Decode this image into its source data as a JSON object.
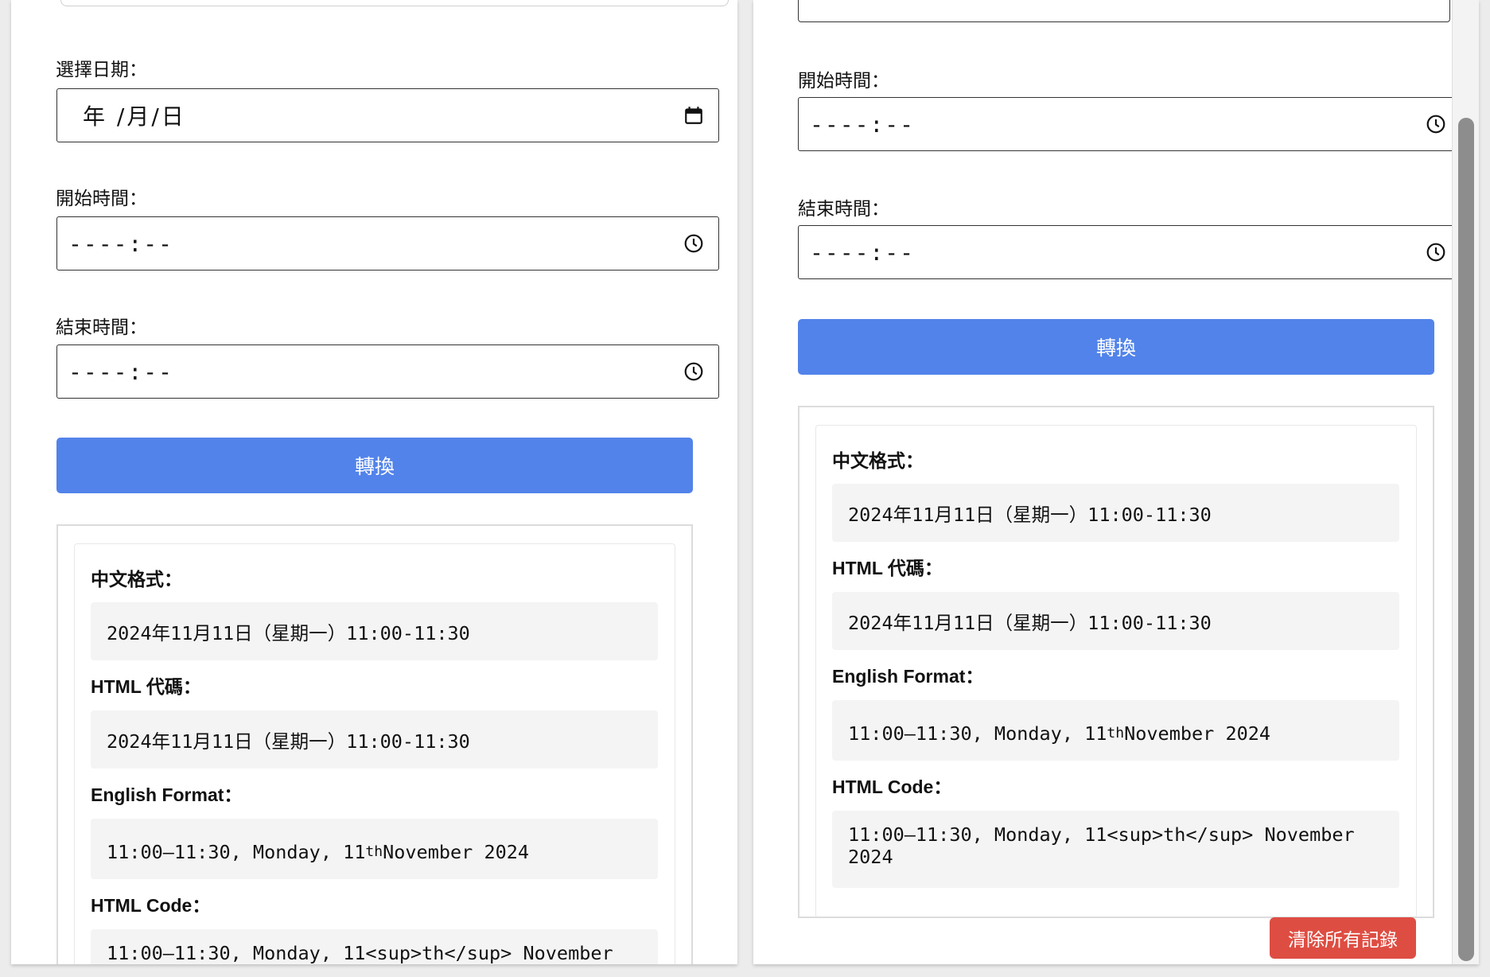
{
  "left": {
    "date_label": "選擇日期：",
    "date_value": "年 /月/日",
    "start_label": "開始時間：",
    "start_value": "----:--",
    "end_label": "結束時間：",
    "end_value": "----:--",
    "convert_label": "轉換",
    "chinese_title": "中文格式：",
    "chinese_value": "2024年11月11日（星期一）11:00-11:30",
    "html_title": "HTML 代碼：",
    "html_value": "2024年11月11日（星期一）11:00-11:30",
    "english_title": "English Format：",
    "english_before": "11:00–11:30, Monday, 11",
    "english_sup": "th",
    "english_after": " November 2024",
    "html_code_title": "HTML Code：",
    "html_code_value": "11:00–11:30, Monday, 11<sup>th</sup> November"
  },
  "right": {
    "start_label": "開始時間：",
    "start_value": "----:--",
    "end_label": "結束時間：",
    "end_value": "----:--",
    "convert_label": "轉換",
    "chinese_title": "中文格式：",
    "chinese_value": "2024年11月11日（星期一）11:00-11:30",
    "html_title": "HTML 代碼：",
    "html_value": "2024年11月11日（星期一）11:00-11:30",
    "english_title": "English Format：",
    "english_before": "11:00–11:30, Monday, 11",
    "english_sup": "th",
    "english_after": " November 2024",
    "html_code_title": "HTML Code：",
    "html_code_value": "11:00–11:30, Monday, 11<sup>th</sup> November 2024",
    "clear_label": "清除所有記錄"
  },
  "colors": {
    "convert_button": "#5283ea",
    "clear_button": "#de4d42"
  }
}
